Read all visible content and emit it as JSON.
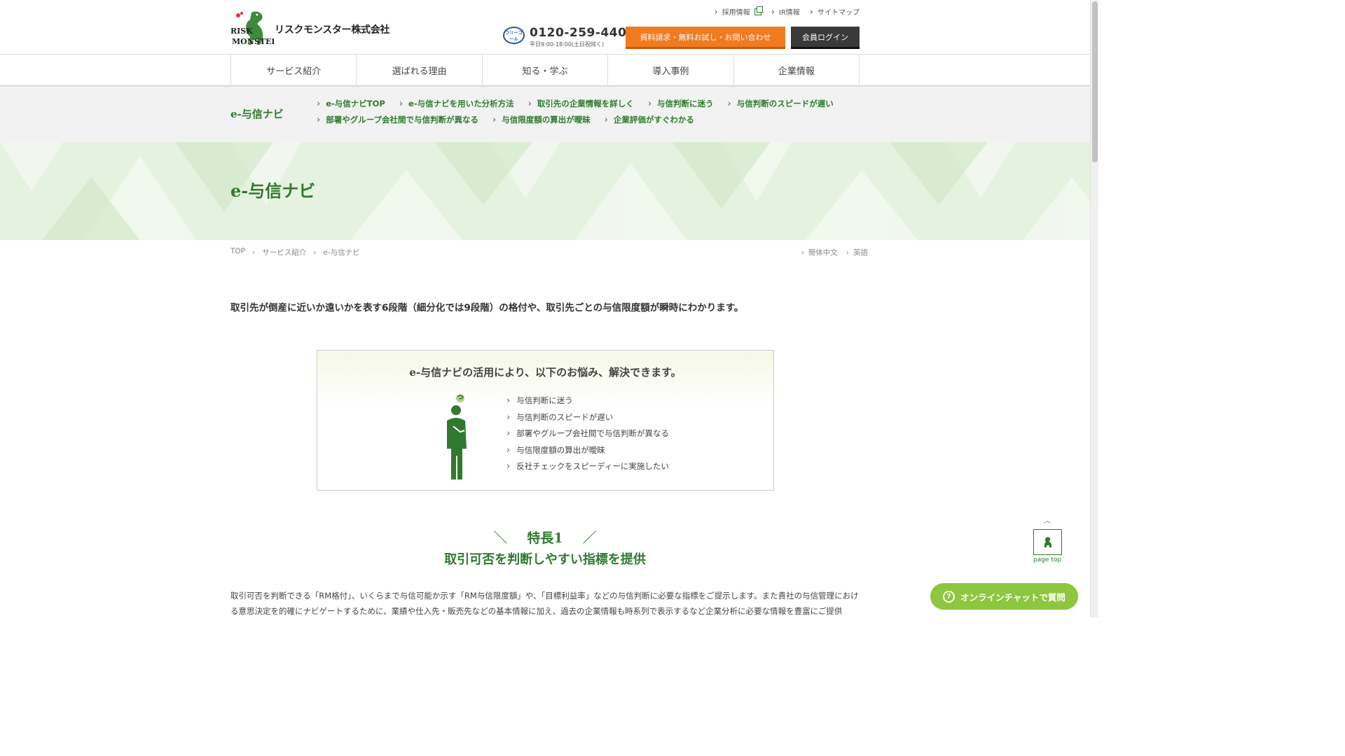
{
  "header": {
    "company_name": "リスクモンスター株式会社",
    "logo_text_top": "RISK",
    "logo_text_bottom": "MONSTER",
    "top_links": [
      "採用情報",
      "IR情報",
      "サイトマップ"
    ],
    "phone_number": "0120-259-440",
    "phone_hours": "平日9:00-18:00(土日祝除く)",
    "freecall_label": "フリーコール",
    "contact_button": "資料請求・無料お試し・お問い合わせ",
    "login_button": "会員ログイン"
  },
  "nav": {
    "items": [
      "サービス紹介",
      "選ばれる理由",
      "知る・学ぶ",
      "導入事例",
      "企業情報"
    ]
  },
  "subnav": {
    "title": "e-与信ナビ",
    "links": [
      "e-与信ナビTOP",
      "e-与信ナビを用いた分析方法",
      "取引先の企業情報を詳しく",
      "与信判断に迷う",
      "与信判断のスピードが遅い",
      "部署やグループ会社間で与信判断が異なる",
      "与信限度額の算出が曖昧",
      "企業評価がすぐわかる"
    ]
  },
  "hero": {
    "title": "e-与信ナビ"
  },
  "breadcrumb": [
    "TOP",
    "サービス紹介",
    "e-与信ナビ"
  ],
  "languages": [
    "簡体中文",
    "英語"
  ],
  "lead": "取引先が倒産に近いか遠いかを表す6段階（細分化では9段階）の格付や、取引先ごとの与信限度額が瞬時にわかります。",
  "problems": {
    "title": "e-与信ナビの活用により、以下のお悩み、解決できます。",
    "items": [
      "与信判断に迷う",
      "与信判断のスピードが遅い",
      "部署やグループ会社間で与信判断が異なる",
      "与信限度額の算出が曖昧",
      "反社チェックをスピーディーに実施したい"
    ]
  },
  "feature": {
    "label": "特長1",
    "title": "取引可否を判断しやすい指標を提供",
    "body": "取引可否を判断できる「RM格付」、いくらまで与信可能か示す「RM与信限度額」や、「目標利益率」などの与信判断に必要な指標をご提示します。また貴社の与信管理における意思決定を的確にナビゲートするために、業績や仕入先・販売先などの基本情報に加え、過去の企業情報も時系列で表示するなど企業分析に必要な情報を豊富にご提供"
  },
  "floating": {
    "page_top": "page top",
    "chat_button": "オンラインチャットで質問"
  },
  "colors": {
    "brand_green": "#2f7a2f",
    "accent_orange": "#f07a20",
    "chat_green": "#8dc63f"
  }
}
